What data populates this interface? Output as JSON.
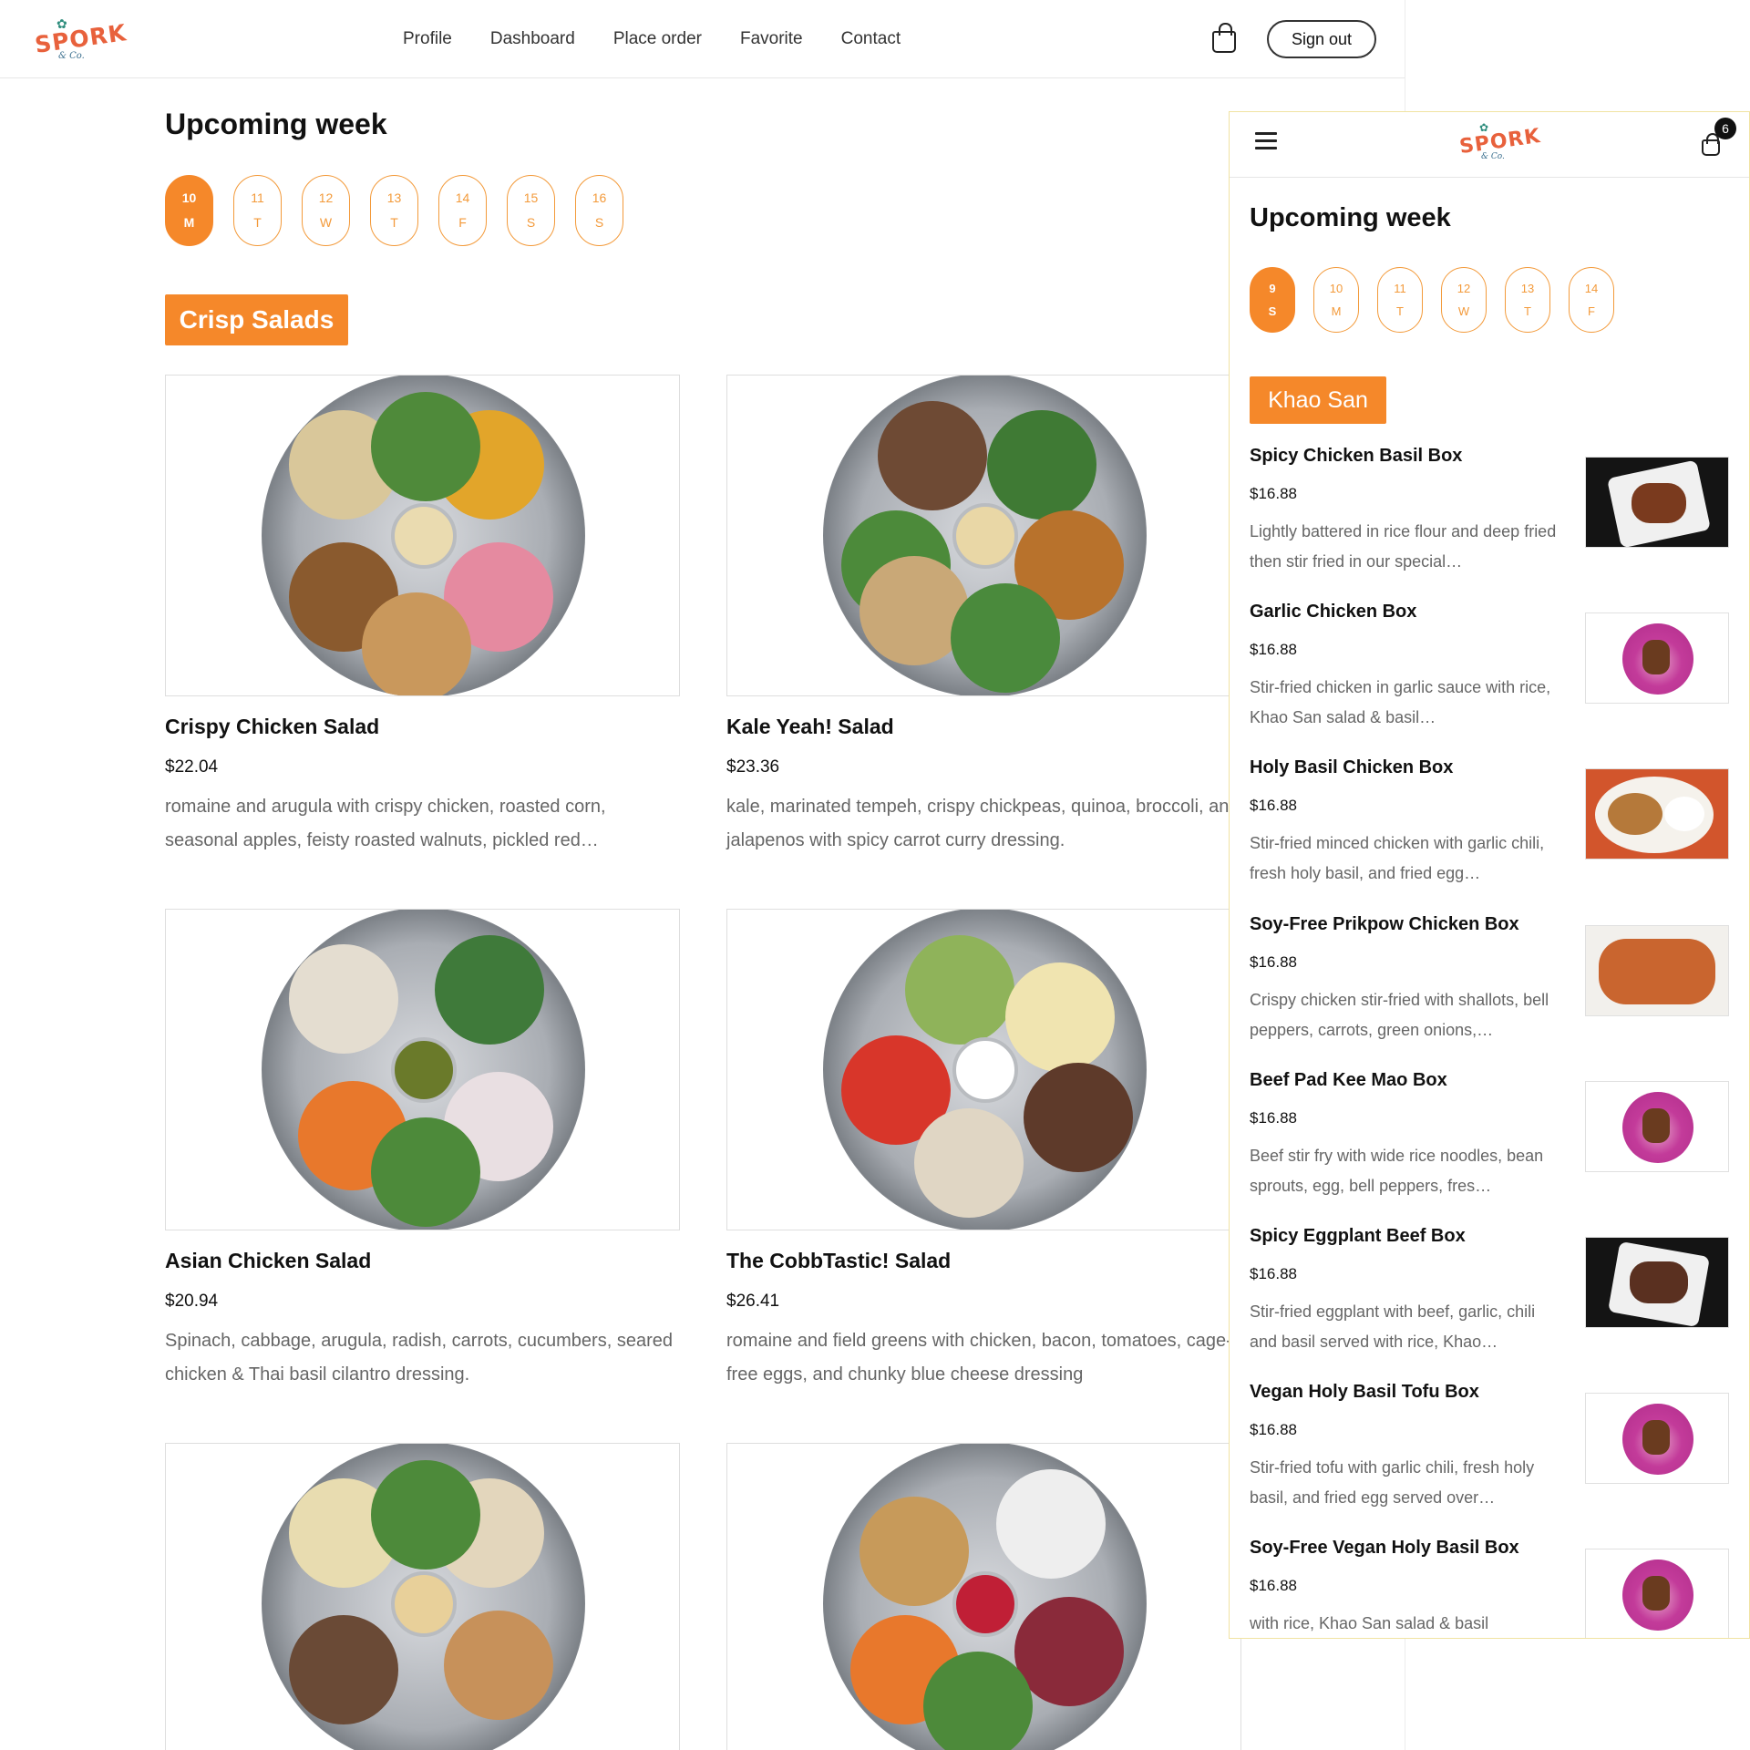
{
  "header": {
    "logo_text": "SPORK",
    "logo_script": "& Co.",
    "nav": [
      "Profile",
      "Dashboard",
      "Place order",
      "Favorite",
      "Contact"
    ],
    "sign_out": "Sign out"
  },
  "desktop": {
    "week_title": "Upcoming week",
    "days": [
      {
        "num": "10",
        "letter": "M",
        "active": true
      },
      {
        "num": "11",
        "letter": "T",
        "active": false
      },
      {
        "num": "12",
        "letter": "W",
        "active": false
      },
      {
        "num": "13",
        "letter": "T",
        "active": false
      },
      {
        "num": "14",
        "letter": "F",
        "active": false
      },
      {
        "num": "15",
        "letter": "S",
        "active": false
      },
      {
        "num": "16",
        "letter": "S",
        "active": false
      }
    ],
    "category": "Crisp Salads",
    "items": [
      {
        "name": "Crispy Chicken Salad",
        "price": "$22.04",
        "desc": "romaine and arugula with crispy chicken, roasted corn, seasonal apples, feisty roasted walnuts, pickled red…"
      },
      {
        "name": "Kale Yeah! Salad",
        "price": "$23.36",
        "desc": "kale, marinated tempeh, crispy chickpeas, quinoa, broccoli, and jalapenos with spicy carrot curry dressing."
      },
      {
        "name": "Asian Chicken Salad",
        "price": "$20.94",
        "desc": "Spinach, cabbage, arugula, radish, carrots, cucumbers, seared chicken & Thai basil cilantro dressing."
      },
      {
        "name": "The CobbTastic! Salad",
        "price": "$26.41",
        "desc": "romaine and field greens with chicken, bacon, tomatoes, cage-free eggs, and chunky blue cheese dressing"
      },
      {
        "name": "",
        "price": "",
        "desc": ""
      },
      {
        "name": "",
        "price": "",
        "desc": ""
      }
    ]
  },
  "mobile": {
    "cart_count": "6",
    "week_title": "Upcoming week",
    "days": [
      {
        "num": "9",
        "letter": "S",
        "active": true
      },
      {
        "num": "10",
        "letter": "M",
        "active": false
      },
      {
        "num": "11",
        "letter": "T",
        "active": false
      },
      {
        "num": "12",
        "letter": "W",
        "active": false
      },
      {
        "num": "13",
        "letter": "T",
        "active": false
      },
      {
        "num": "14",
        "letter": "F",
        "active": false
      }
    ],
    "category": "Khao San",
    "items": [
      {
        "name": "Spicy Chicken Basil Box",
        "price": "$16.88",
        "desc": "Lightly battered in rice flour and deep fried then stir fried in our special…",
        "thumb": "photo"
      },
      {
        "name": "Garlic Chicken Box",
        "price": "$16.88",
        "desc": "Stir-fried chicken in garlic sauce with rice, Khao San salad & basil…",
        "thumb": "logo"
      },
      {
        "name": "Holy Basil Chicken Box",
        "price": "$16.88",
        "desc": "Stir-fried minced chicken with garlic chili, fresh holy basil, and fried egg…",
        "thumb": "photo"
      },
      {
        "name": "Soy-Free Prikpow Chicken Box",
        "price": "$16.88",
        "desc": "Crispy chicken stir-fried with shallots, bell peppers, carrots, green onions,…",
        "thumb": "photo"
      },
      {
        "name": "Beef Pad Kee Mao Box",
        "price": "$16.88",
        "desc": "Beef stir fry with wide rice noodles, bean sprouts, egg, bell peppers, fres…",
        "thumb": "logo"
      },
      {
        "name": "Spicy Eggplant Beef Box",
        "price": "$16.88",
        "desc": "Stir-fried eggplant with beef, garlic, chili and basil served with rice, Khao…",
        "thumb": "photo"
      },
      {
        "name": "Vegan Holy Basil Tofu Box",
        "price": "$16.88",
        "desc": "Stir-fried tofu with garlic chili, fresh holy basil, and fried egg served over…",
        "thumb": "logo"
      },
      {
        "name": "Soy-Free Vegan Holy Basil Box",
        "price": "$16.88",
        "desc": "with rice, Khao San salad & basil",
        "thumb": "logo"
      }
    ]
  },
  "colors": {
    "accent": "#f5882a",
    "logo": "#e8613c"
  },
  "icons": [
    "shopping-bag-icon",
    "hamburger-menu-icon"
  ]
}
